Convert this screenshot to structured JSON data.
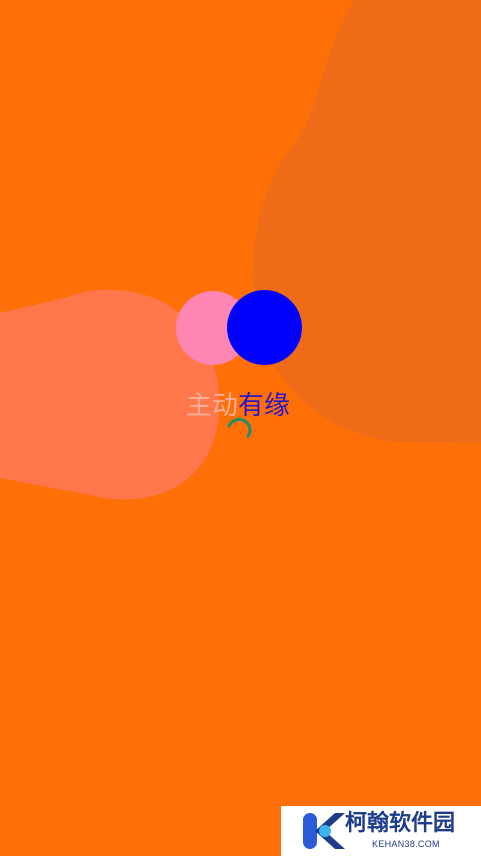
{
  "app": {
    "name_part1": "主动",
    "name_part2": "有缘"
  },
  "colors": {
    "background": "#FF6F08",
    "blob_right": "#EE6C17",
    "blob_left": "#FF774A",
    "logo_pink": "#FF85B3",
    "logo_blue": "#0000FF",
    "spinner": "#1A8F6A"
  },
  "loading": {
    "icon": "loading-spinner-icon"
  },
  "watermark": {
    "title": "柯翰软件园",
    "subtitle": "KEHAN38.COM",
    "logo_icon": "k-logo-icon"
  }
}
